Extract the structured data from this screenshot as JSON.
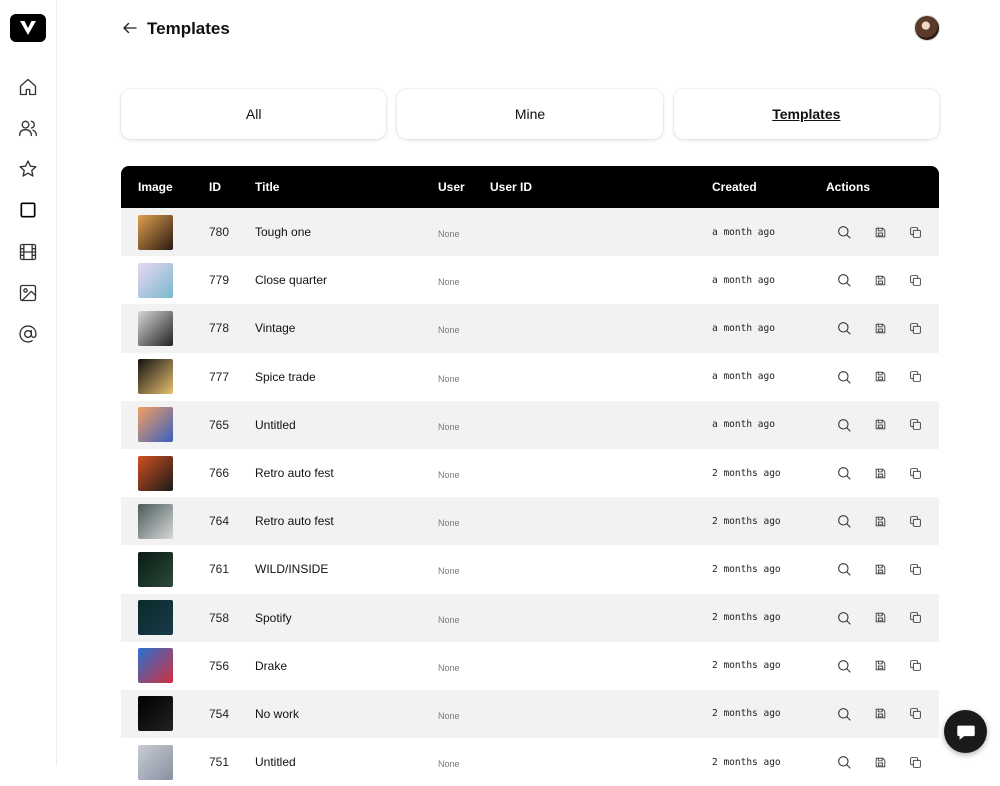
{
  "page": {
    "title": "Templates",
    "tabs": [
      {
        "label": "All",
        "active": false
      },
      {
        "label": "Mine",
        "active": false
      },
      {
        "label": "Templates",
        "active": true
      }
    ]
  },
  "sidebar": {
    "icons": [
      "home-icon",
      "users-icon",
      "star-icon",
      "square-icon",
      "film-icon",
      "image-icon",
      "at-icon"
    ],
    "active": "square-icon"
  },
  "table": {
    "headers": {
      "image": "Image",
      "id": "ID",
      "title": "Title",
      "user": "User",
      "user_id": "User ID",
      "created": "Created",
      "actions": "Actions"
    },
    "rows": [
      {
        "id": "780",
        "title": "Tough one",
        "user": "None",
        "created": "a month ago",
        "thumb": [
          "#e0a050",
          "#2a1a10"
        ]
      },
      {
        "id": "779",
        "title": "Close quarter",
        "user": "None",
        "created": "a month ago",
        "thumb": [
          "#e8d8f0",
          "#7ab8d0"
        ]
      },
      {
        "id": "778",
        "title": "Vintage",
        "user": "None",
        "created": "a month ago",
        "thumb": [
          "#d8d8d8",
          "#222222"
        ]
      },
      {
        "id": "777",
        "title": "Spice trade",
        "user": "None",
        "created": "a month ago",
        "thumb": [
          "#111111",
          "#e8c070"
        ]
      },
      {
        "id": "765",
        "title": "Untitled",
        "user": "None",
        "created": "a month ago",
        "thumb": [
          "#f4a060",
          "#3a60c0"
        ]
      },
      {
        "id": "766",
        "title": "Retro auto fest",
        "user": "None",
        "created": "2 months ago",
        "thumb": [
          "#d05020",
          "#1a1a1a"
        ]
      },
      {
        "id": "764",
        "title": "Retro auto fest",
        "user": "None",
        "created": "2 months ago",
        "thumb": [
          "#4a5a5a",
          "#d8d8d8"
        ]
      },
      {
        "id": "761",
        "title": "WILD/INSIDE",
        "user": "None",
        "created": "2 months ago",
        "thumb": [
          "#0a1a14",
          "#2a4a3a"
        ]
      },
      {
        "id": "758",
        "title": "Spotify",
        "user": "None",
        "created": "2 months ago",
        "thumb": [
          "#0a2a2a",
          "#1a3a4a"
        ]
      },
      {
        "id": "756",
        "title": "Drake",
        "user": "None",
        "created": "2 months ago",
        "thumb": [
          "#2a70d0",
          "#d03040"
        ]
      },
      {
        "id": "754",
        "title": "No work",
        "user": "None",
        "created": "2 months ago",
        "thumb": [
          "#000000",
          "#222222"
        ]
      },
      {
        "id": "751",
        "title": "Untitled",
        "user": "None",
        "created": "2 months ago",
        "thumb": [
          "#c8ccd4",
          "#8890a0"
        ]
      }
    ]
  },
  "colors": {
    "header_bg": "#000000",
    "row_alt": "#f2f2f2",
    "accent": "#111111"
  }
}
